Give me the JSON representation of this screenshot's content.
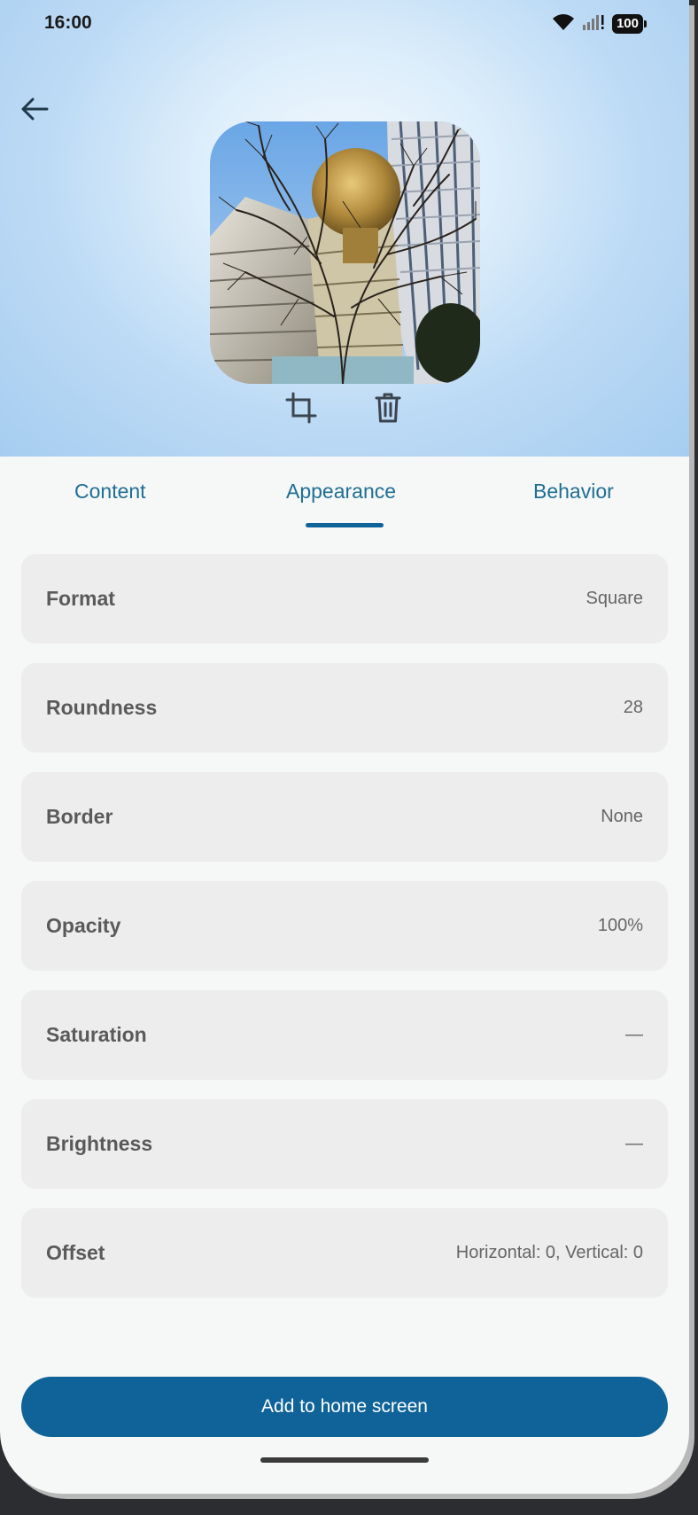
{
  "status_bar": {
    "time": "16:00",
    "battery": "100"
  },
  "header": {
    "back_icon": "arrow-left-icon",
    "crop_icon": "crop-icon",
    "delete_icon": "trash-icon"
  },
  "tabs": [
    {
      "label": "Content",
      "selected": false
    },
    {
      "label": "Appearance",
      "selected": true
    },
    {
      "label": "Behavior",
      "selected": false
    }
  ],
  "settings": [
    {
      "label": "Format",
      "value": "Square"
    },
    {
      "label": "Roundness",
      "value": "28"
    },
    {
      "label": "Border",
      "value": "None"
    },
    {
      "label": "Opacity",
      "value": "100%"
    },
    {
      "label": "Saturation",
      "value": "—"
    },
    {
      "label": "Brightness",
      "value": "—"
    },
    {
      "label": "Offset",
      "value": "Horizontal: 0, Vertical: 0"
    }
  ],
  "primary_action": {
    "label": "Add to home screen"
  },
  "colors": {
    "accent": "#0f6399",
    "tab_text": "#1f6f93",
    "row_background": "#ededed"
  }
}
